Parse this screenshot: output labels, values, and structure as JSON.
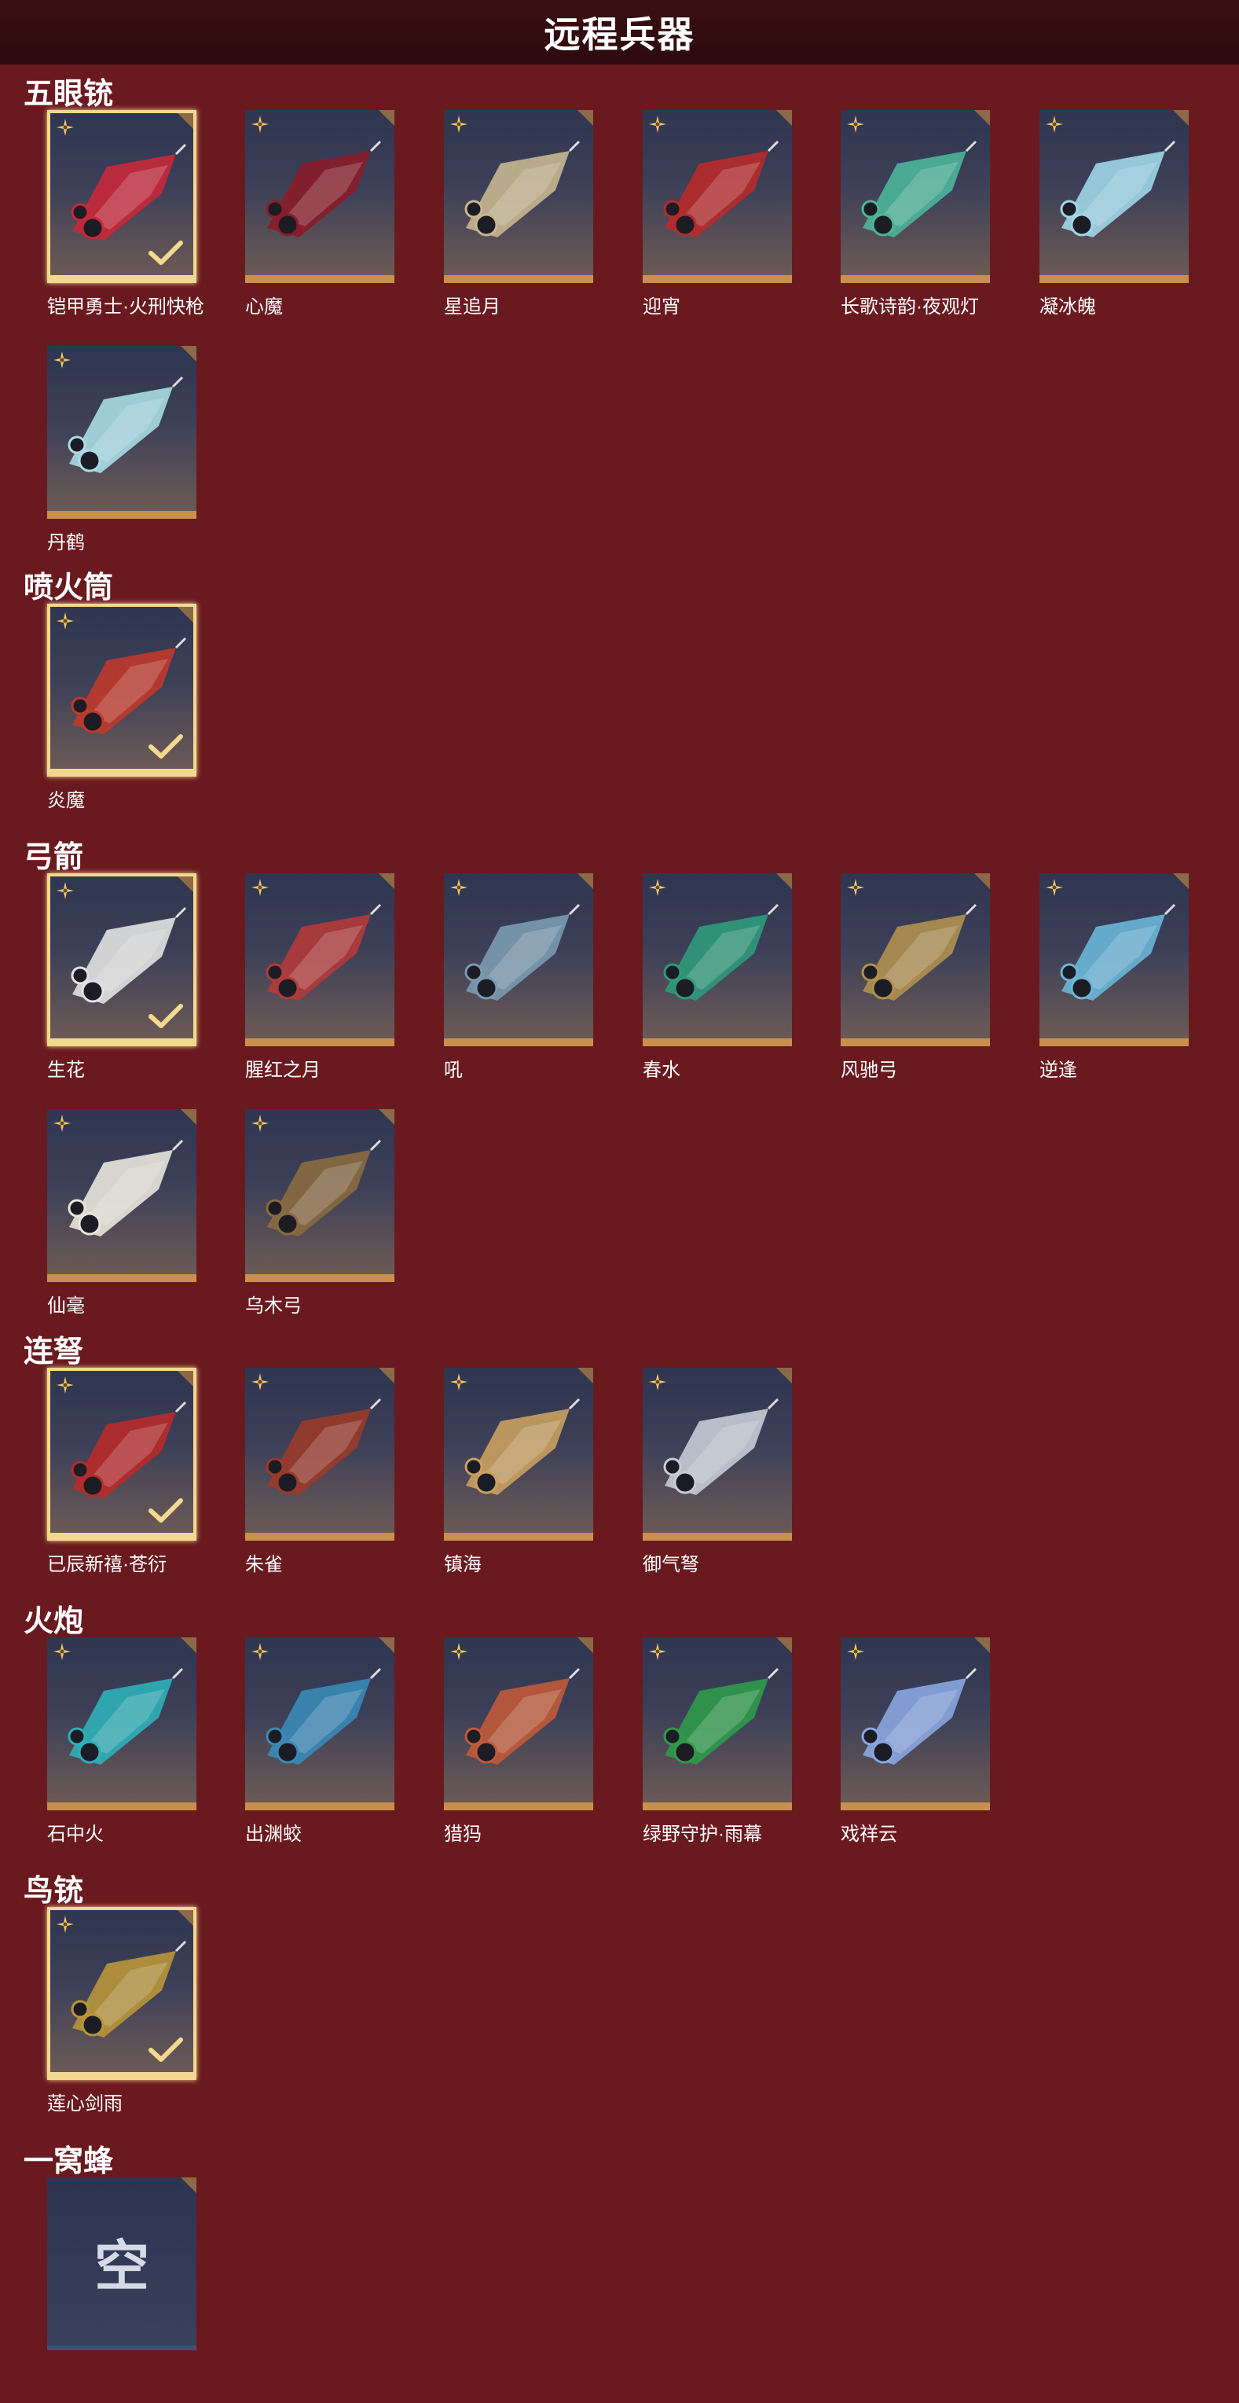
{
  "title": "远程兵器",
  "colors": {
    "background": "#6a1a1f",
    "card_bottom": "#c98f4d",
    "selected_border": "#f3d98f"
  },
  "sections": [
    {
      "name": "五眼铳",
      "items": [
        {
          "label": "铠甲勇士·火刑快枪",
          "selected": true,
          "color": "#c8283a"
        },
        {
          "label": "心魔",
          "selected": false,
          "color": "#8a1c2a"
        },
        {
          "label": "星追月",
          "selected": false,
          "color": "#c7b690"
        },
        {
          "label": "迎宵",
          "selected": false,
          "color": "#b82a2a"
        },
        {
          "label": "长歌诗韵·夜观灯",
          "selected": false,
          "color": "#4bb59a"
        },
        {
          "label": "凝冰魄",
          "selected": false,
          "color": "#9fd6e8"
        },
        {
          "label": "丹鹤",
          "selected": false,
          "color": "#a9dce6"
        }
      ]
    },
    {
      "name": "喷火筒",
      "items": [
        {
          "label": "炎魔",
          "selected": true,
          "color": "#c0392b"
        }
      ]
    },
    {
      "name": "弓箭",
      "items": [
        {
          "label": "生花",
          "selected": true,
          "color": "#e2e2e2"
        },
        {
          "label": "腥红之月",
          "selected": false,
          "color": "#b23a3a"
        },
        {
          "label": "吼",
          "selected": false,
          "color": "#7a9ab0"
        },
        {
          "label": "春水",
          "selected": false,
          "color": "#2f9a7a"
        },
        {
          "label": "风驰弓",
          "selected": false,
          "color": "#b09050"
        },
        {
          "label": "逆逢",
          "selected": false,
          "color": "#6ab6d8"
        },
        {
          "label": "仙毫",
          "selected": false,
          "color": "#e8e6dc"
        },
        {
          "label": "乌木弓",
          "selected": false,
          "color": "#8a6a40"
        }
      ]
    },
    {
      "name": "连弩",
      "items": [
        {
          "label": "已辰新禧·苍衍",
          "selected": true,
          "color": "#b82a2a"
        },
        {
          "label": "朱雀",
          "selected": false,
          "color": "#9a3a2a"
        },
        {
          "label": "镇海",
          "selected": false,
          "color": "#c9a060"
        },
        {
          "label": "御气弩",
          "selected": false,
          "color": "#c6cbd6"
        }
      ]
    },
    {
      "name": "火炮",
      "items": [
        {
          "label": "石中火",
          "selected": false,
          "color": "#2fb0b8"
        },
        {
          "label": "出渊蛟",
          "selected": false,
          "color": "#3a8ab8"
        },
        {
          "label": "猎犸",
          "selected": false,
          "color": "#c05a3a"
        },
        {
          "label": "绿野守护·雨幕",
          "selected": false,
          "color": "#2f9a4a"
        },
        {
          "label": "戏祥云",
          "selected": false,
          "color": "#8aa6e0"
        }
      ]
    },
    {
      "name": "鸟铳",
      "items": [
        {
          "label": "莲心剑雨",
          "selected": true,
          "color": "#b8963a"
        }
      ]
    },
    {
      "name": "一窝蜂",
      "items": [
        {
          "label": "",
          "selected": false,
          "empty": true,
          "empty_text": "空"
        }
      ]
    }
  ]
}
